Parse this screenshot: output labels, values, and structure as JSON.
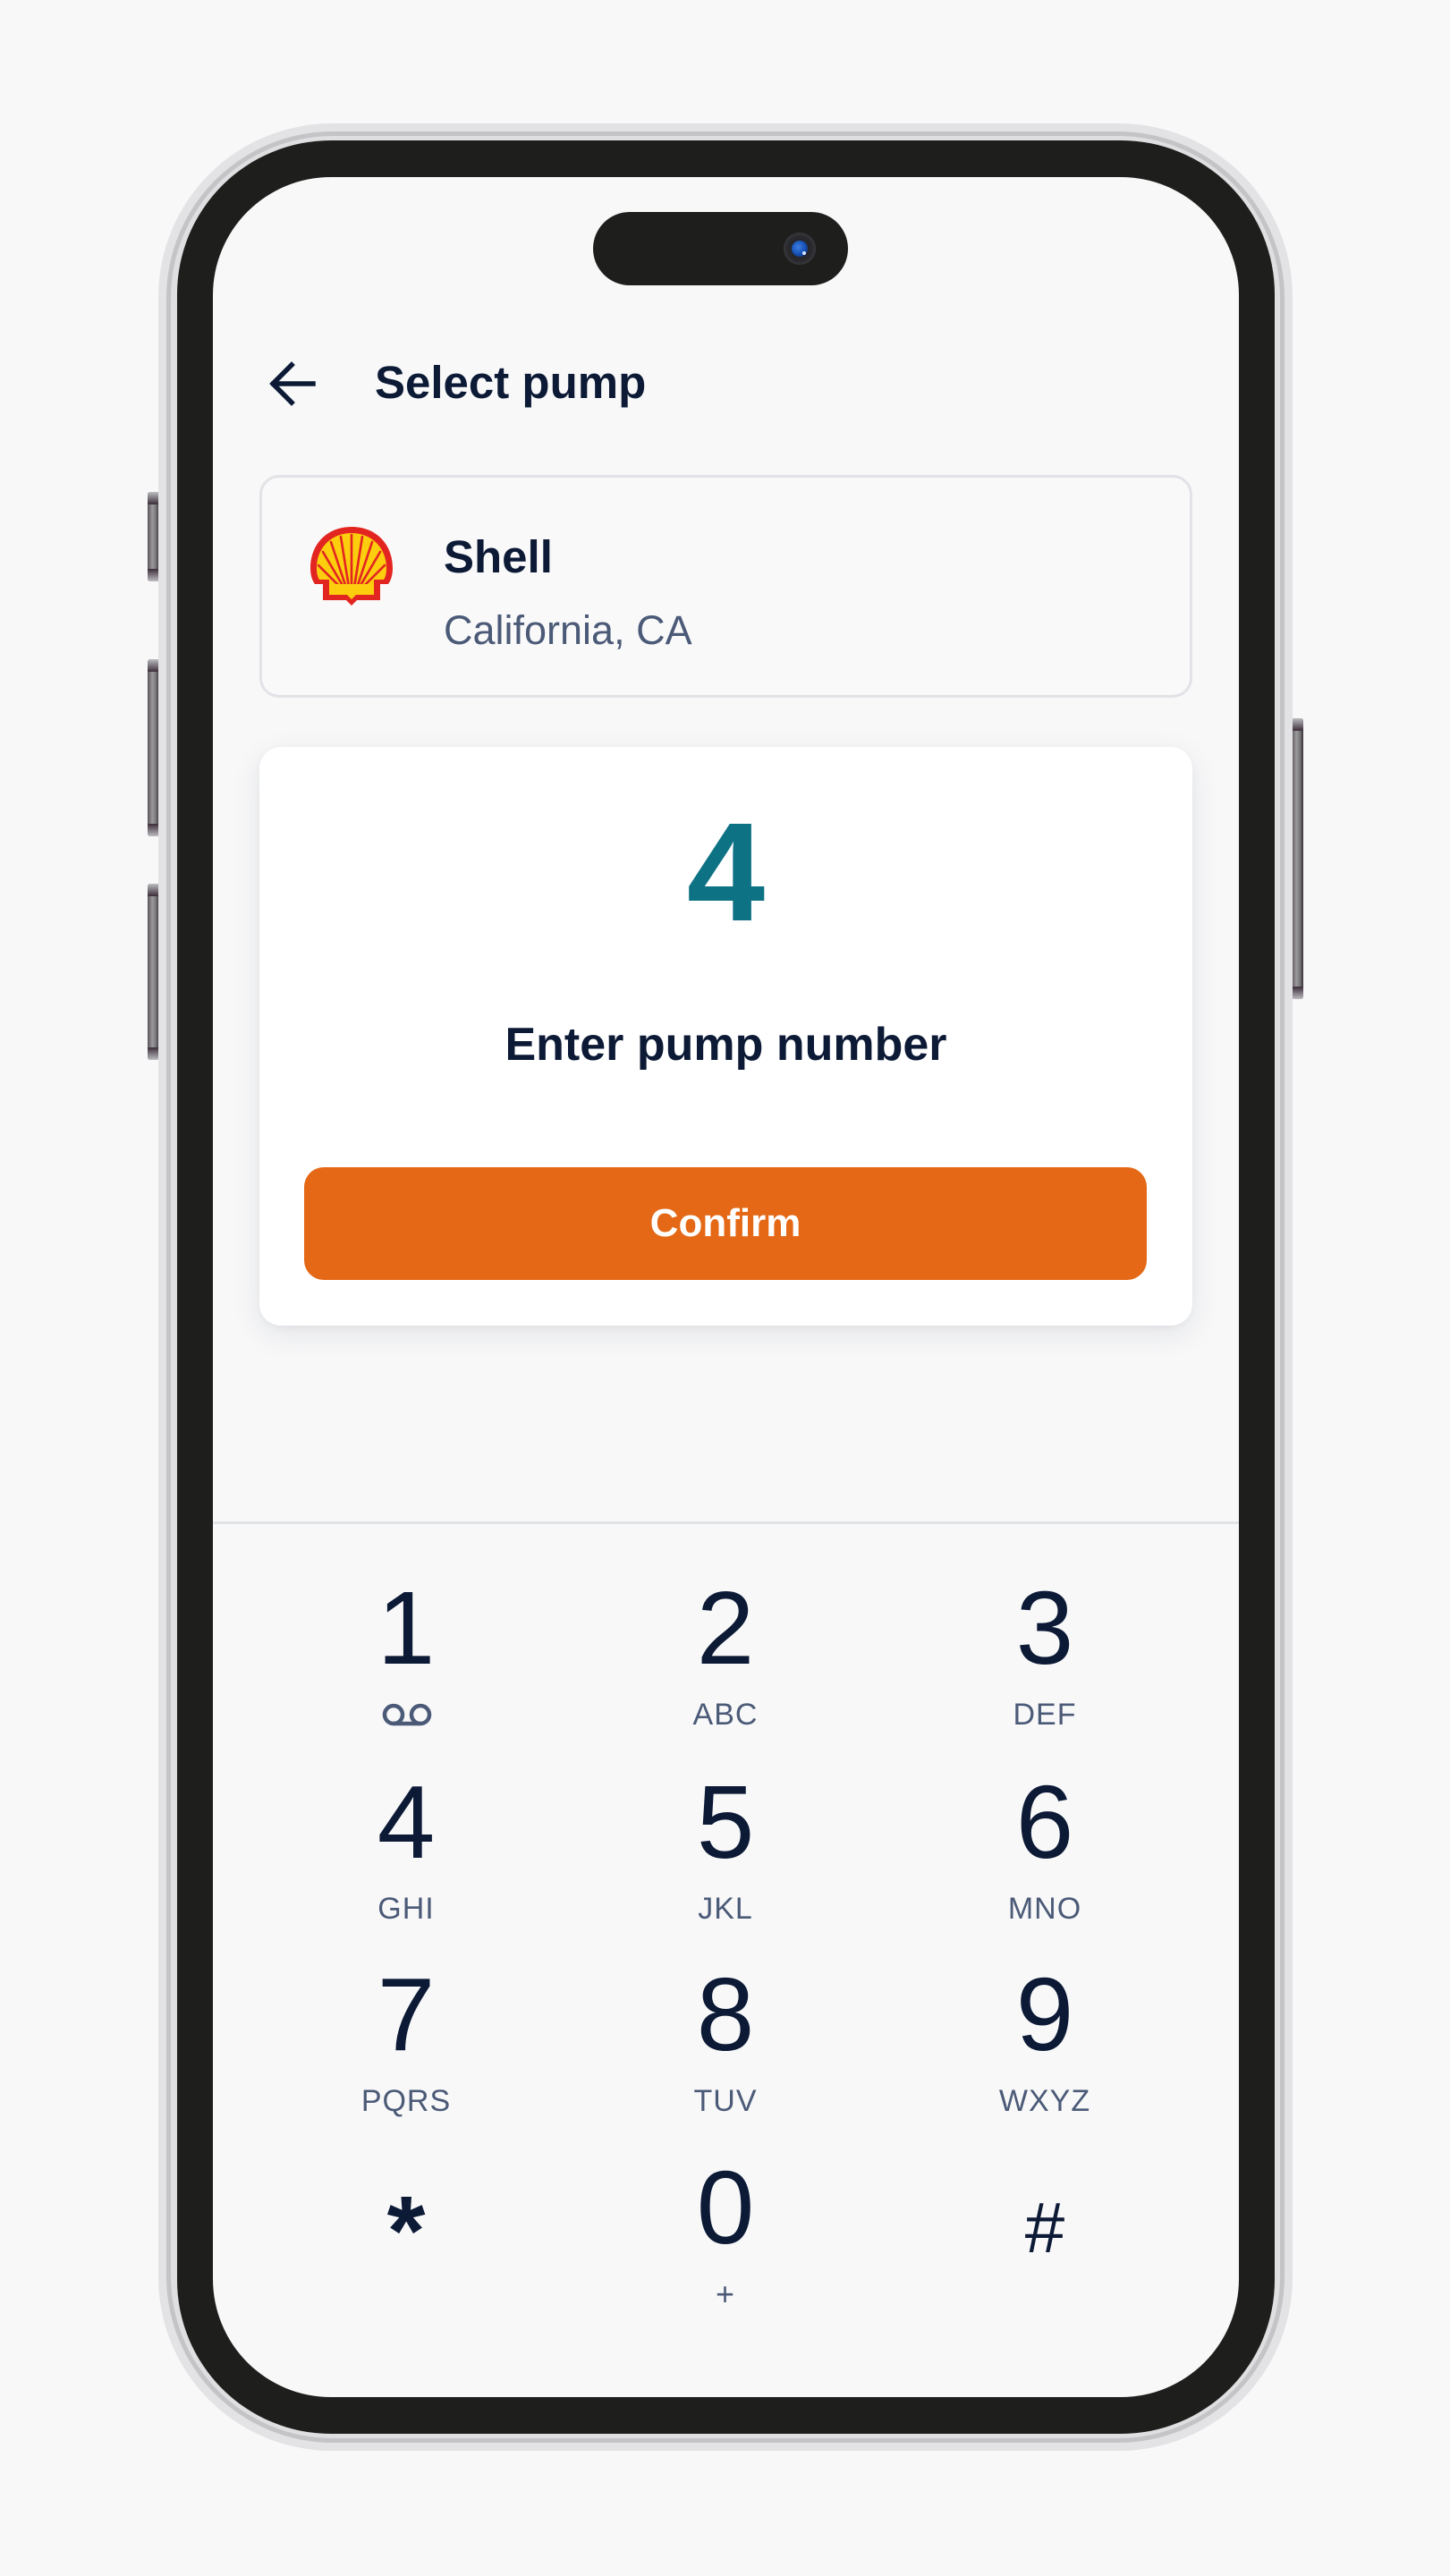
{
  "header": {
    "back_label": "Back",
    "title": "Select pump"
  },
  "station": {
    "brand": "Shell",
    "location": "California, CA",
    "logo_icon": "shell-logo-icon"
  },
  "pump_entry": {
    "value": "4",
    "prompt": "Enter pump number",
    "confirm_label": "Confirm"
  },
  "keypad": {
    "keys": [
      {
        "digit": "1",
        "letters": "",
        "icon": "voicemail-icon"
      },
      {
        "digit": "2",
        "letters": "ABC"
      },
      {
        "digit": "3",
        "letters": "DEF"
      },
      {
        "digit": "4",
        "letters": "GHI"
      },
      {
        "digit": "5",
        "letters": "JKL"
      },
      {
        "digit": "6",
        "letters": "MNO"
      },
      {
        "digit": "7",
        "letters": "PQRS"
      },
      {
        "digit": "8",
        "letters": "TUV"
      },
      {
        "digit": "9",
        "letters": "WXYZ"
      },
      {
        "digit": "*",
        "letters": ""
      },
      {
        "digit": "0",
        "letters": "+"
      },
      {
        "digit": "#",
        "letters": ""
      }
    ]
  },
  "colors": {
    "accent": "#e46816",
    "pump_number": "#0e7285",
    "text_primary": "#0c1a36",
    "text_secondary": "#4b5a77",
    "background": "#f8f8f9"
  }
}
